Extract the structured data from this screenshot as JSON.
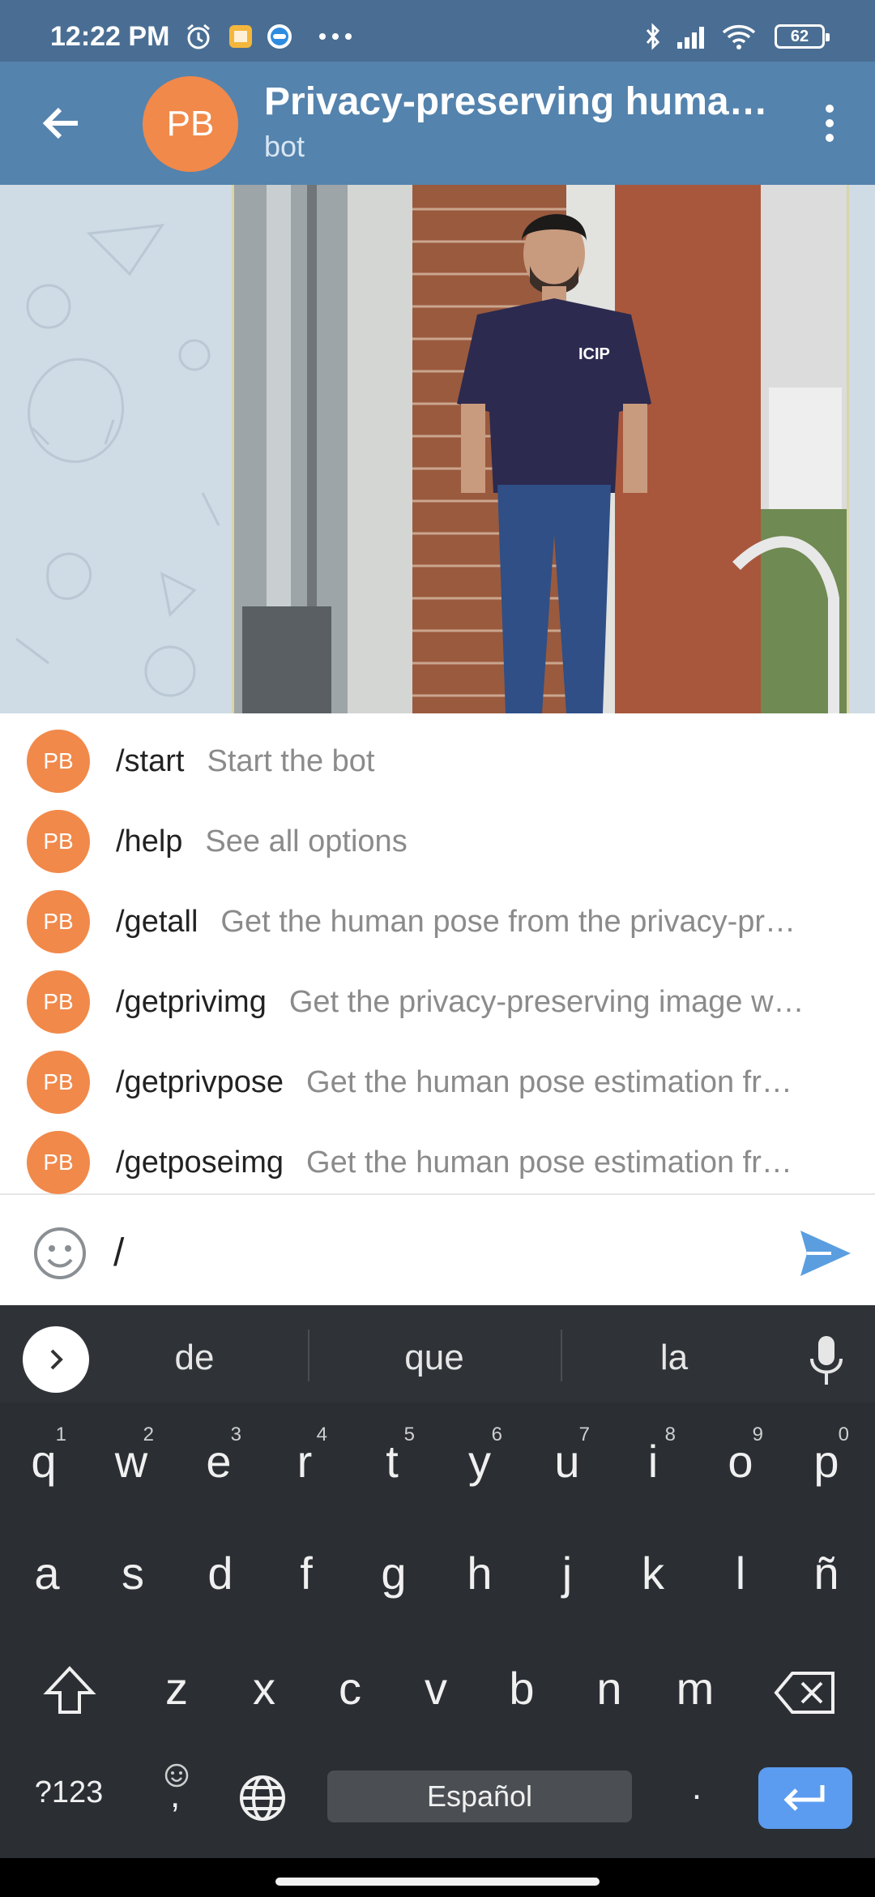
{
  "status_bar": {
    "time": "12:22 PM",
    "battery": "62",
    "icons": [
      "alarm-icon",
      "notes-app-icon",
      "messenger-app-icon",
      "more-icon",
      "bluetooth-icon",
      "signal-icon",
      "wifi-icon",
      "battery-icon"
    ]
  },
  "header": {
    "avatar_initials": "PB",
    "title": "Privacy-preserving human…",
    "subtitle": "bot",
    "back_icon": "arrow-left-icon",
    "menu_icon": "more-vertical-icon"
  },
  "commands": [
    {
      "avatar": "PB",
      "name": "/start",
      "desc": "Start the bot"
    },
    {
      "avatar": "PB",
      "name": "/help",
      "desc": "See all options"
    },
    {
      "avatar": "PB",
      "name": "/getall",
      "desc": "Get the human pose from the privacy-pr…"
    },
    {
      "avatar": "PB",
      "name": "/getprivimg",
      "desc": "Get the privacy-preserving image w…"
    },
    {
      "avatar": "PB",
      "name": "/getprivpose",
      "desc": "Get the human pose estimation fr…"
    },
    {
      "avatar": "PB",
      "name": "/getposeimg",
      "desc": "Get the human pose estimation fr…"
    }
  ],
  "input": {
    "value": "/",
    "emoji_icon": "smiley-icon",
    "send_icon": "send-icon"
  },
  "keyboard": {
    "suggestions": [
      "de",
      "que",
      "la"
    ],
    "row1": [
      {
        "key": "q",
        "hint": "1"
      },
      {
        "key": "w",
        "hint": "2"
      },
      {
        "key": "e",
        "hint": "3"
      },
      {
        "key": "r",
        "hint": "4"
      },
      {
        "key": "t",
        "hint": "5"
      },
      {
        "key": "y",
        "hint": "6"
      },
      {
        "key": "u",
        "hint": "7"
      },
      {
        "key": "i",
        "hint": "8"
      },
      {
        "key": "o",
        "hint": "9"
      },
      {
        "key": "p",
        "hint": "0"
      }
    ],
    "row2": [
      "a",
      "s",
      "d",
      "f",
      "g",
      "h",
      "j",
      "k",
      "l",
      "ñ"
    ],
    "row3": [
      "z",
      "x",
      "c",
      "v",
      "b",
      "n",
      "m"
    ],
    "symbols_key": "?123",
    "emoji_comma_key": ",",
    "space_label": "Español",
    "period_key": ".",
    "colors": {
      "accent": "#5b9cf0",
      "header": "#5483ad",
      "avatar": "#f1894a"
    }
  },
  "photo": {
    "shirt_logo": "ICIP"
  }
}
